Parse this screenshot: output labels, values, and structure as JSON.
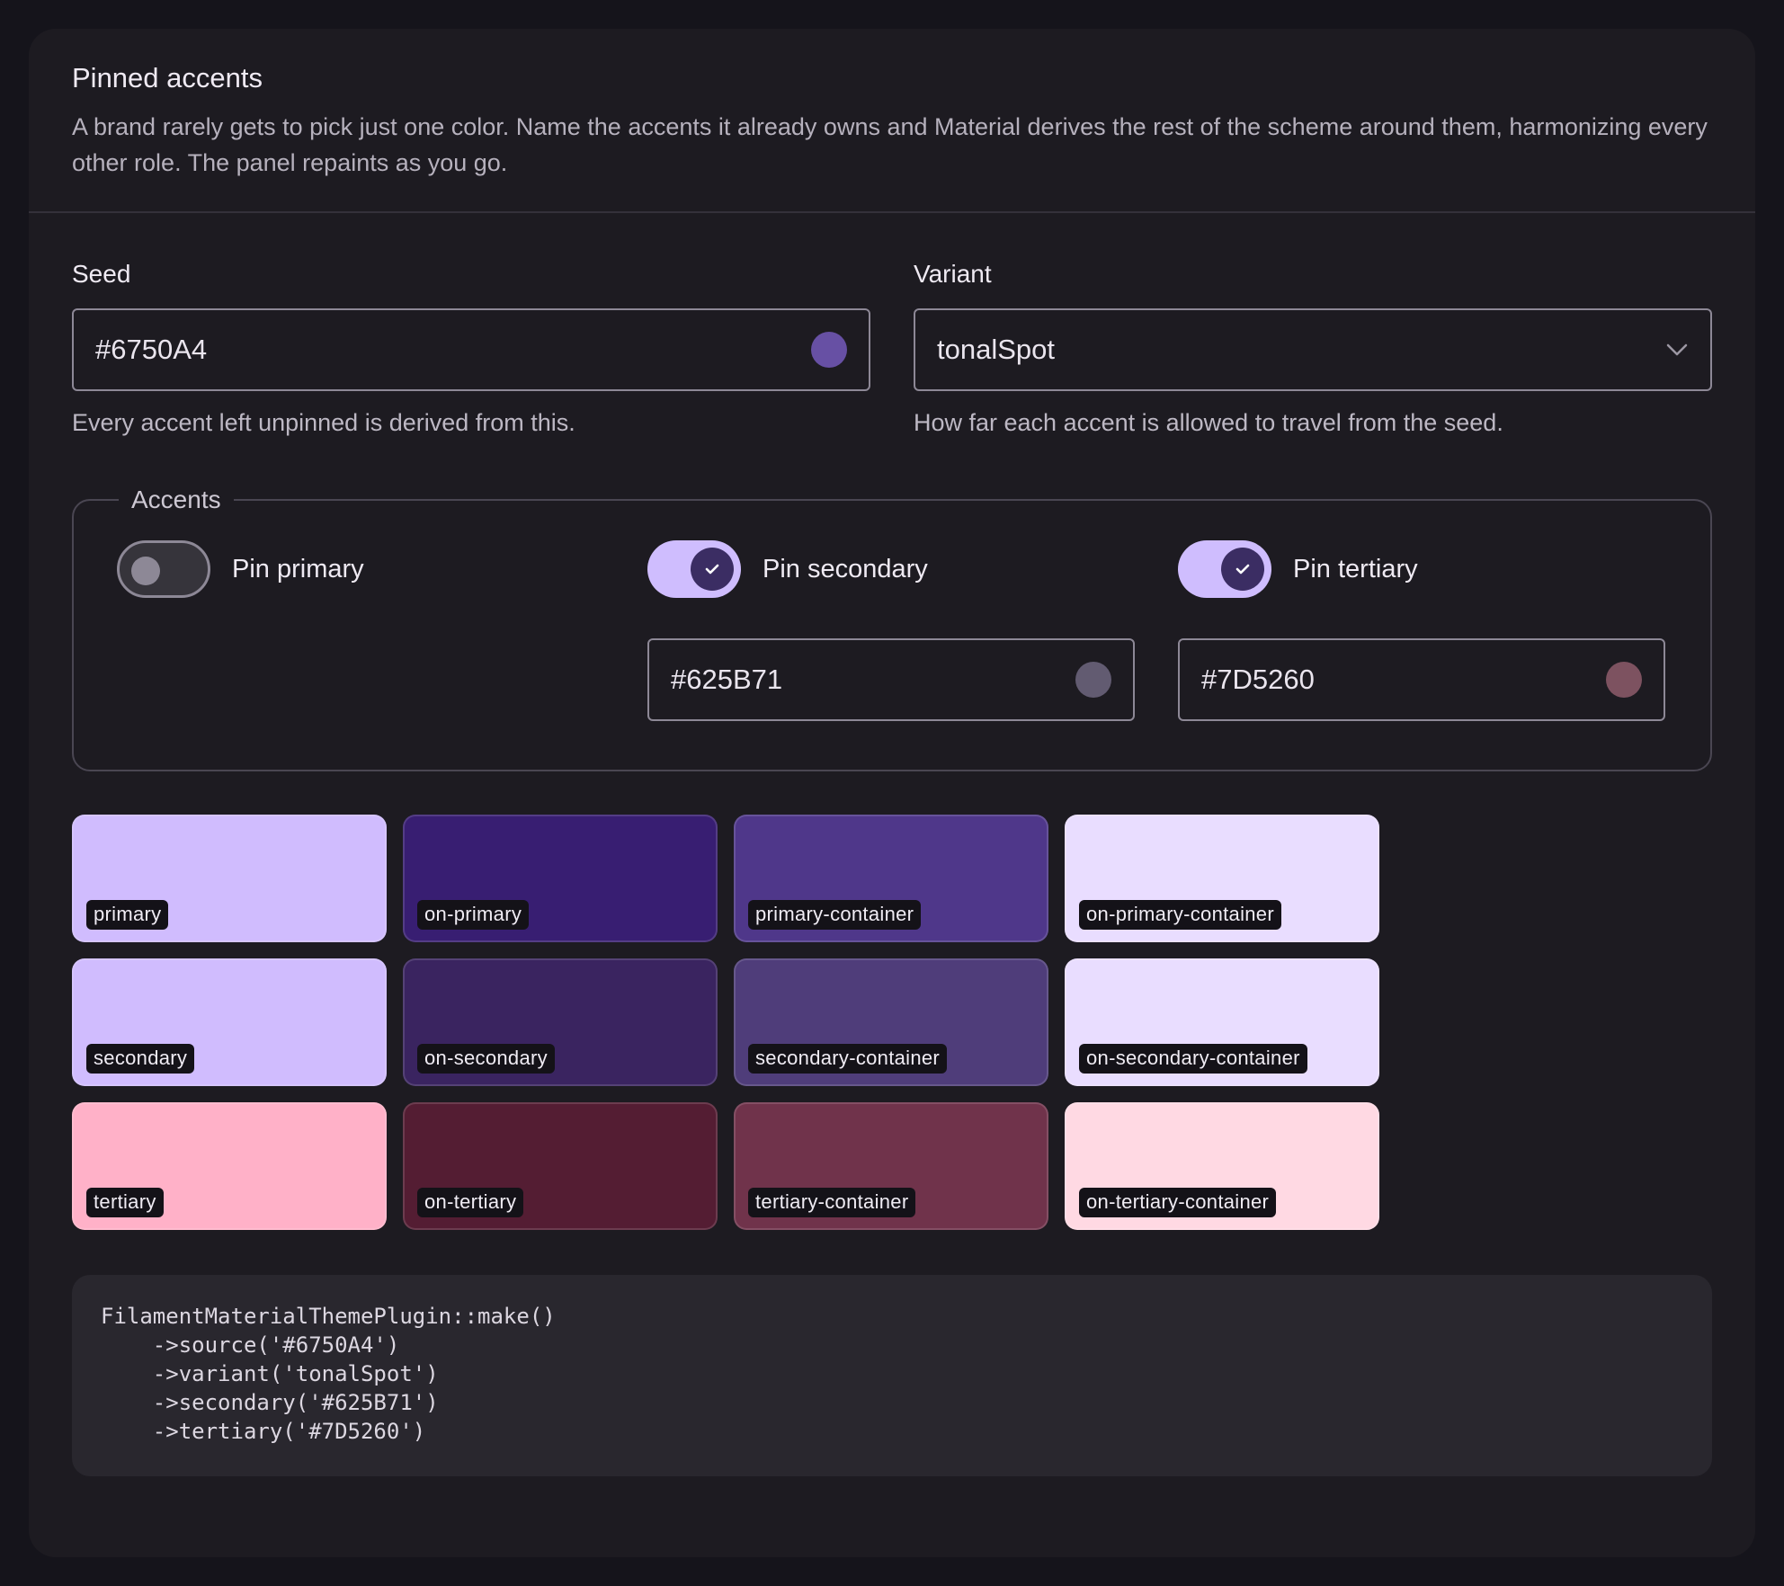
{
  "header": {
    "title": "Pinned accents",
    "description": "A brand rarely gets to pick just one color. Name the accents it already owns and Material derives the rest of the scheme around them, harmonizing every other role. The panel repaints as you go."
  },
  "seed": {
    "label": "Seed",
    "value": "#6750A4",
    "swatch_color": "#6750A4",
    "help": "Every accent left unpinned is derived from this."
  },
  "variant": {
    "label": "Variant",
    "value": "tonalSpot",
    "icon": "chevron-down-icon",
    "help": "How far each accent is allowed to travel from the seed."
  },
  "accents": {
    "legend": "Accents",
    "items": [
      {
        "label": "Pin primary",
        "on": false
      },
      {
        "label": "Pin secondary",
        "on": true,
        "value": "#625B71",
        "swatch_color": "#625B71"
      },
      {
        "label": "Pin tertiary",
        "on": true,
        "value": "#7D5260",
        "swatch_color": "#7D5260"
      }
    ]
  },
  "swatches": [
    {
      "label": "primary",
      "color": "#d0bcfe"
    },
    {
      "label": "on-primary",
      "color": "#381e72"
    },
    {
      "label": "primary-container",
      "color": "#4f378a"
    },
    {
      "label": "on-primary-container",
      "color": "#e9ddff"
    },
    {
      "label": "secondary",
      "color": "#d0bcfe"
    },
    {
      "label": "on-secondary",
      "color": "#3a2460"
    },
    {
      "label": "secondary-container",
      "color": "#4f3d7a"
    },
    {
      "label": "on-secondary-container",
      "color": "#e9ddff"
    },
    {
      "label": "tertiary",
      "color": "#ffb1c8"
    },
    {
      "label": "on-tertiary",
      "color": "#541d33"
    },
    {
      "label": "tertiary-container",
      "color": "#70334b"
    },
    {
      "label": "on-tertiary-container",
      "color": "#ffd9e3"
    }
  ],
  "code": {
    "lines": [
      "FilamentMaterialThemePlugin::make()",
      "    ->source('#6750A4')",
      "    ->variant('tonalSpot')",
      "    ->secondary('#625B71')",
      "    ->tertiary('#7D5260')"
    ]
  }
}
